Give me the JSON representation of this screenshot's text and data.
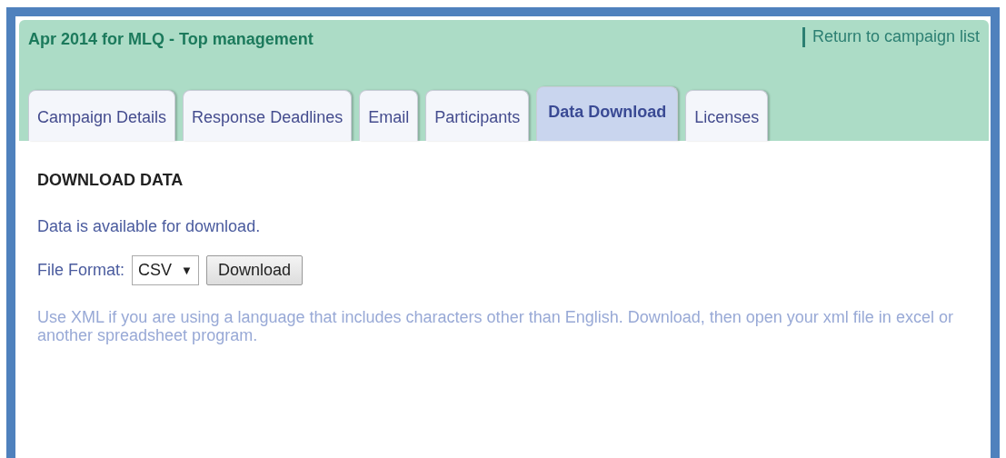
{
  "header": {
    "title": "Apr 2014 for MLQ - Top management",
    "return_link": "Return to campaign list"
  },
  "tabs": [
    {
      "label": "Campaign Details",
      "selected": false
    },
    {
      "label": "Response Deadlines",
      "selected": false
    },
    {
      "label": "Email",
      "selected": false
    },
    {
      "label": "Participants",
      "selected": false
    },
    {
      "label": "Data Download",
      "selected": true
    },
    {
      "label": "Licenses",
      "selected": false
    }
  ],
  "section": {
    "heading": "DOWNLOAD DATA",
    "status": "Data is available for download.",
    "format_label": "File Format:",
    "format_value": "CSV",
    "format_caret": "▼",
    "button": "Download",
    "note": "Use XML if you are using a language that includes characters other than English. Download, then open your xml file in excel or another spreadsheet program."
  }
}
